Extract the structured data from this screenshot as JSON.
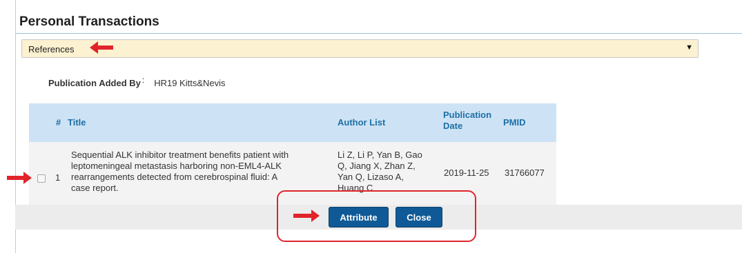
{
  "panel": {
    "title": "Personal Transactions"
  },
  "dropdown": {
    "value": "References"
  },
  "added_by": {
    "label": "Publication Added By",
    "colon": ":",
    "value": "HR19 Kitts&Nevis"
  },
  "table": {
    "headers": {
      "index": "#",
      "title": "Title",
      "authors": "Author List",
      "date": "Publication Date",
      "pmid": "PMID"
    },
    "rows": [
      {
        "index": "1",
        "title_lines": [
          "Sequential ALK inhibitor treatment benefits patient with",
          "leptomeningeal metastasis harboring non-EML4-ALK",
          "rearrangements detected from cerebrospinal fluid: A",
          "case report."
        ],
        "author_lines": [
          "Li Z, Li P, Yan B, Gao",
          "Q, Jiang X, Zhan Z,",
          "Yan Q, Lizaso A,",
          "Huang C"
        ],
        "date": "2019-11-25",
        "pmid": "31766077"
      }
    ]
  },
  "buttons": {
    "attribute": "Attribute",
    "close": "Close"
  },
  "colors": {
    "annotation_red": "#e0242a",
    "button_blue": "#0f5a96",
    "header_blue": "#cde3f5",
    "dropdown_bg": "#fcf1d0"
  }
}
